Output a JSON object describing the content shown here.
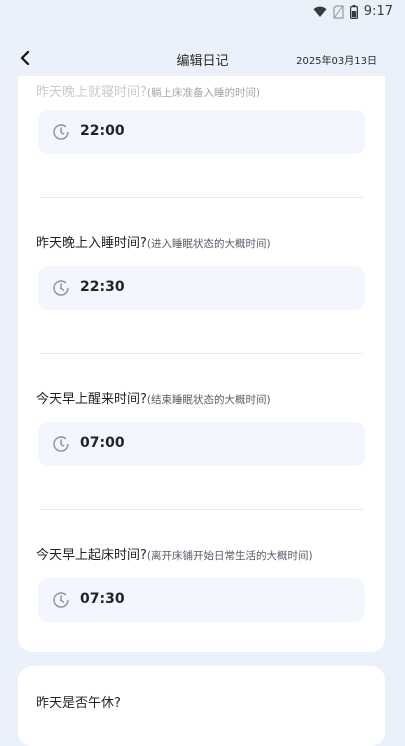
{
  "status": {
    "time": "9:17"
  },
  "nav": {
    "title": "编辑日记",
    "date": "2025年03月13日"
  },
  "questions": [
    {
      "title": "昨天晚上就寝时间?",
      "hint": "(躺上床准备入睡的时间)",
      "value": "22:00"
    },
    {
      "title": "昨天晚上入睡时间?",
      "hint": "(进入睡眠状态的大概时间)",
      "value": "22:30"
    },
    {
      "title": "今天早上醒来时间?",
      "hint": "(结束睡眠状态的大概时间)",
      "value": "07:00"
    },
    {
      "title": "今天早上起床时间?",
      "hint": "(离开床铺开始日常生活的大概时间)",
      "value": "07:30"
    }
  ],
  "nap": {
    "title": "昨天是否午休?"
  },
  "icons": {
    "back": "chevron-left-icon",
    "time": "clock-icon",
    "wifi": "wifi-icon",
    "sim": "sim-icon",
    "battery": "battery-icon"
  }
}
